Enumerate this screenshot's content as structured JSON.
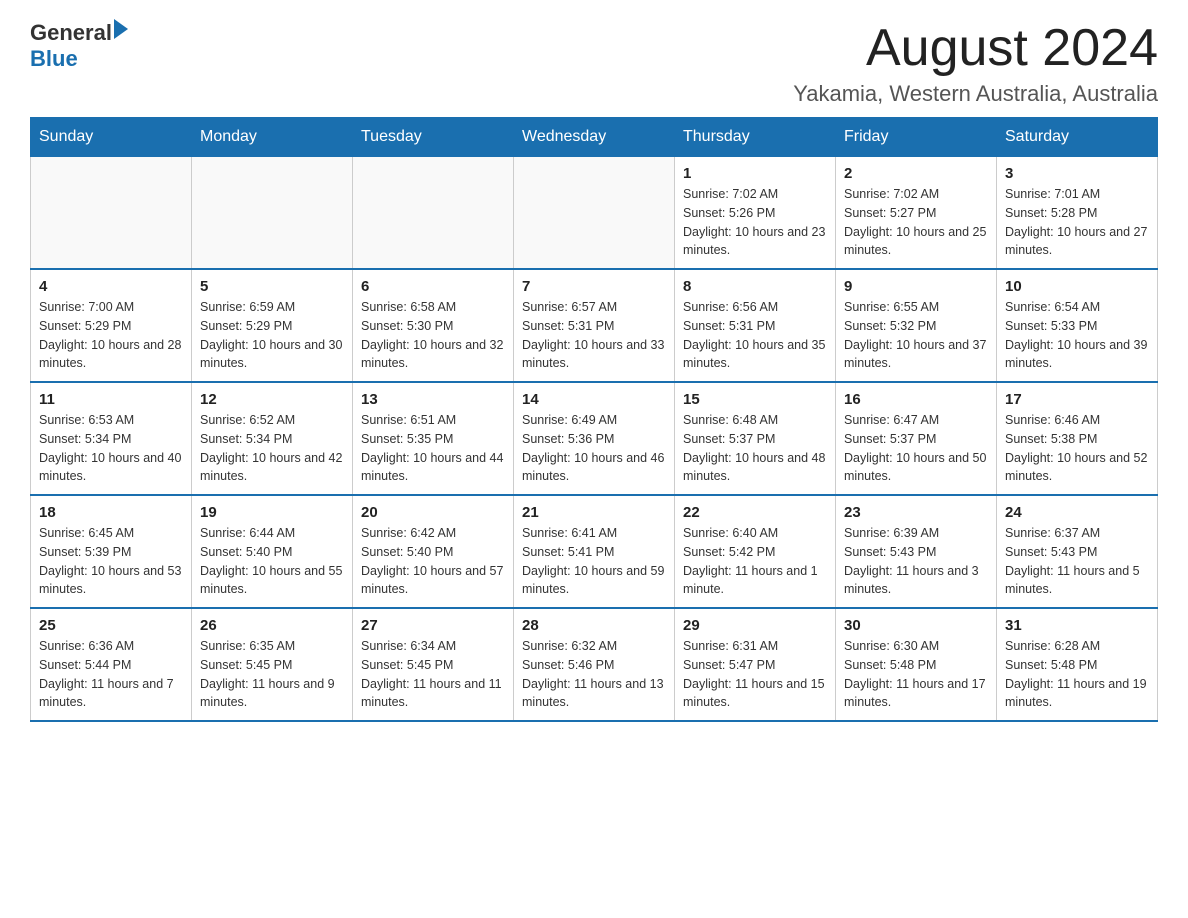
{
  "header": {
    "logo_general": "General",
    "logo_blue": "Blue",
    "month_title": "August 2024",
    "location": "Yakamia, Western Australia, Australia"
  },
  "days_of_week": [
    "Sunday",
    "Monday",
    "Tuesday",
    "Wednesday",
    "Thursday",
    "Friday",
    "Saturday"
  ],
  "weeks": [
    [
      {
        "day": "",
        "info": ""
      },
      {
        "day": "",
        "info": ""
      },
      {
        "day": "",
        "info": ""
      },
      {
        "day": "",
        "info": ""
      },
      {
        "day": "1",
        "info": "Sunrise: 7:02 AM\nSunset: 5:26 PM\nDaylight: 10 hours and 23 minutes."
      },
      {
        "day": "2",
        "info": "Sunrise: 7:02 AM\nSunset: 5:27 PM\nDaylight: 10 hours and 25 minutes."
      },
      {
        "day": "3",
        "info": "Sunrise: 7:01 AM\nSunset: 5:28 PM\nDaylight: 10 hours and 27 minutes."
      }
    ],
    [
      {
        "day": "4",
        "info": "Sunrise: 7:00 AM\nSunset: 5:29 PM\nDaylight: 10 hours and 28 minutes."
      },
      {
        "day": "5",
        "info": "Sunrise: 6:59 AM\nSunset: 5:29 PM\nDaylight: 10 hours and 30 minutes."
      },
      {
        "day": "6",
        "info": "Sunrise: 6:58 AM\nSunset: 5:30 PM\nDaylight: 10 hours and 32 minutes."
      },
      {
        "day": "7",
        "info": "Sunrise: 6:57 AM\nSunset: 5:31 PM\nDaylight: 10 hours and 33 minutes."
      },
      {
        "day": "8",
        "info": "Sunrise: 6:56 AM\nSunset: 5:31 PM\nDaylight: 10 hours and 35 minutes."
      },
      {
        "day": "9",
        "info": "Sunrise: 6:55 AM\nSunset: 5:32 PM\nDaylight: 10 hours and 37 minutes."
      },
      {
        "day": "10",
        "info": "Sunrise: 6:54 AM\nSunset: 5:33 PM\nDaylight: 10 hours and 39 minutes."
      }
    ],
    [
      {
        "day": "11",
        "info": "Sunrise: 6:53 AM\nSunset: 5:34 PM\nDaylight: 10 hours and 40 minutes."
      },
      {
        "day": "12",
        "info": "Sunrise: 6:52 AM\nSunset: 5:34 PM\nDaylight: 10 hours and 42 minutes."
      },
      {
        "day": "13",
        "info": "Sunrise: 6:51 AM\nSunset: 5:35 PM\nDaylight: 10 hours and 44 minutes."
      },
      {
        "day": "14",
        "info": "Sunrise: 6:49 AM\nSunset: 5:36 PM\nDaylight: 10 hours and 46 minutes."
      },
      {
        "day": "15",
        "info": "Sunrise: 6:48 AM\nSunset: 5:37 PM\nDaylight: 10 hours and 48 minutes."
      },
      {
        "day": "16",
        "info": "Sunrise: 6:47 AM\nSunset: 5:37 PM\nDaylight: 10 hours and 50 minutes."
      },
      {
        "day": "17",
        "info": "Sunrise: 6:46 AM\nSunset: 5:38 PM\nDaylight: 10 hours and 52 minutes."
      }
    ],
    [
      {
        "day": "18",
        "info": "Sunrise: 6:45 AM\nSunset: 5:39 PM\nDaylight: 10 hours and 53 minutes."
      },
      {
        "day": "19",
        "info": "Sunrise: 6:44 AM\nSunset: 5:40 PM\nDaylight: 10 hours and 55 minutes."
      },
      {
        "day": "20",
        "info": "Sunrise: 6:42 AM\nSunset: 5:40 PM\nDaylight: 10 hours and 57 minutes."
      },
      {
        "day": "21",
        "info": "Sunrise: 6:41 AM\nSunset: 5:41 PM\nDaylight: 10 hours and 59 minutes."
      },
      {
        "day": "22",
        "info": "Sunrise: 6:40 AM\nSunset: 5:42 PM\nDaylight: 11 hours and 1 minute."
      },
      {
        "day": "23",
        "info": "Sunrise: 6:39 AM\nSunset: 5:43 PM\nDaylight: 11 hours and 3 minutes."
      },
      {
        "day": "24",
        "info": "Sunrise: 6:37 AM\nSunset: 5:43 PM\nDaylight: 11 hours and 5 minutes."
      }
    ],
    [
      {
        "day": "25",
        "info": "Sunrise: 6:36 AM\nSunset: 5:44 PM\nDaylight: 11 hours and 7 minutes."
      },
      {
        "day": "26",
        "info": "Sunrise: 6:35 AM\nSunset: 5:45 PM\nDaylight: 11 hours and 9 minutes."
      },
      {
        "day": "27",
        "info": "Sunrise: 6:34 AM\nSunset: 5:45 PM\nDaylight: 11 hours and 11 minutes."
      },
      {
        "day": "28",
        "info": "Sunrise: 6:32 AM\nSunset: 5:46 PM\nDaylight: 11 hours and 13 minutes."
      },
      {
        "day": "29",
        "info": "Sunrise: 6:31 AM\nSunset: 5:47 PM\nDaylight: 11 hours and 15 minutes."
      },
      {
        "day": "30",
        "info": "Sunrise: 6:30 AM\nSunset: 5:48 PM\nDaylight: 11 hours and 17 minutes."
      },
      {
        "day": "31",
        "info": "Sunrise: 6:28 AM\nSunset: 5:48 PM\nDaylight: 11 hours and 19 minutes."
      }
    ]
  ]
}
